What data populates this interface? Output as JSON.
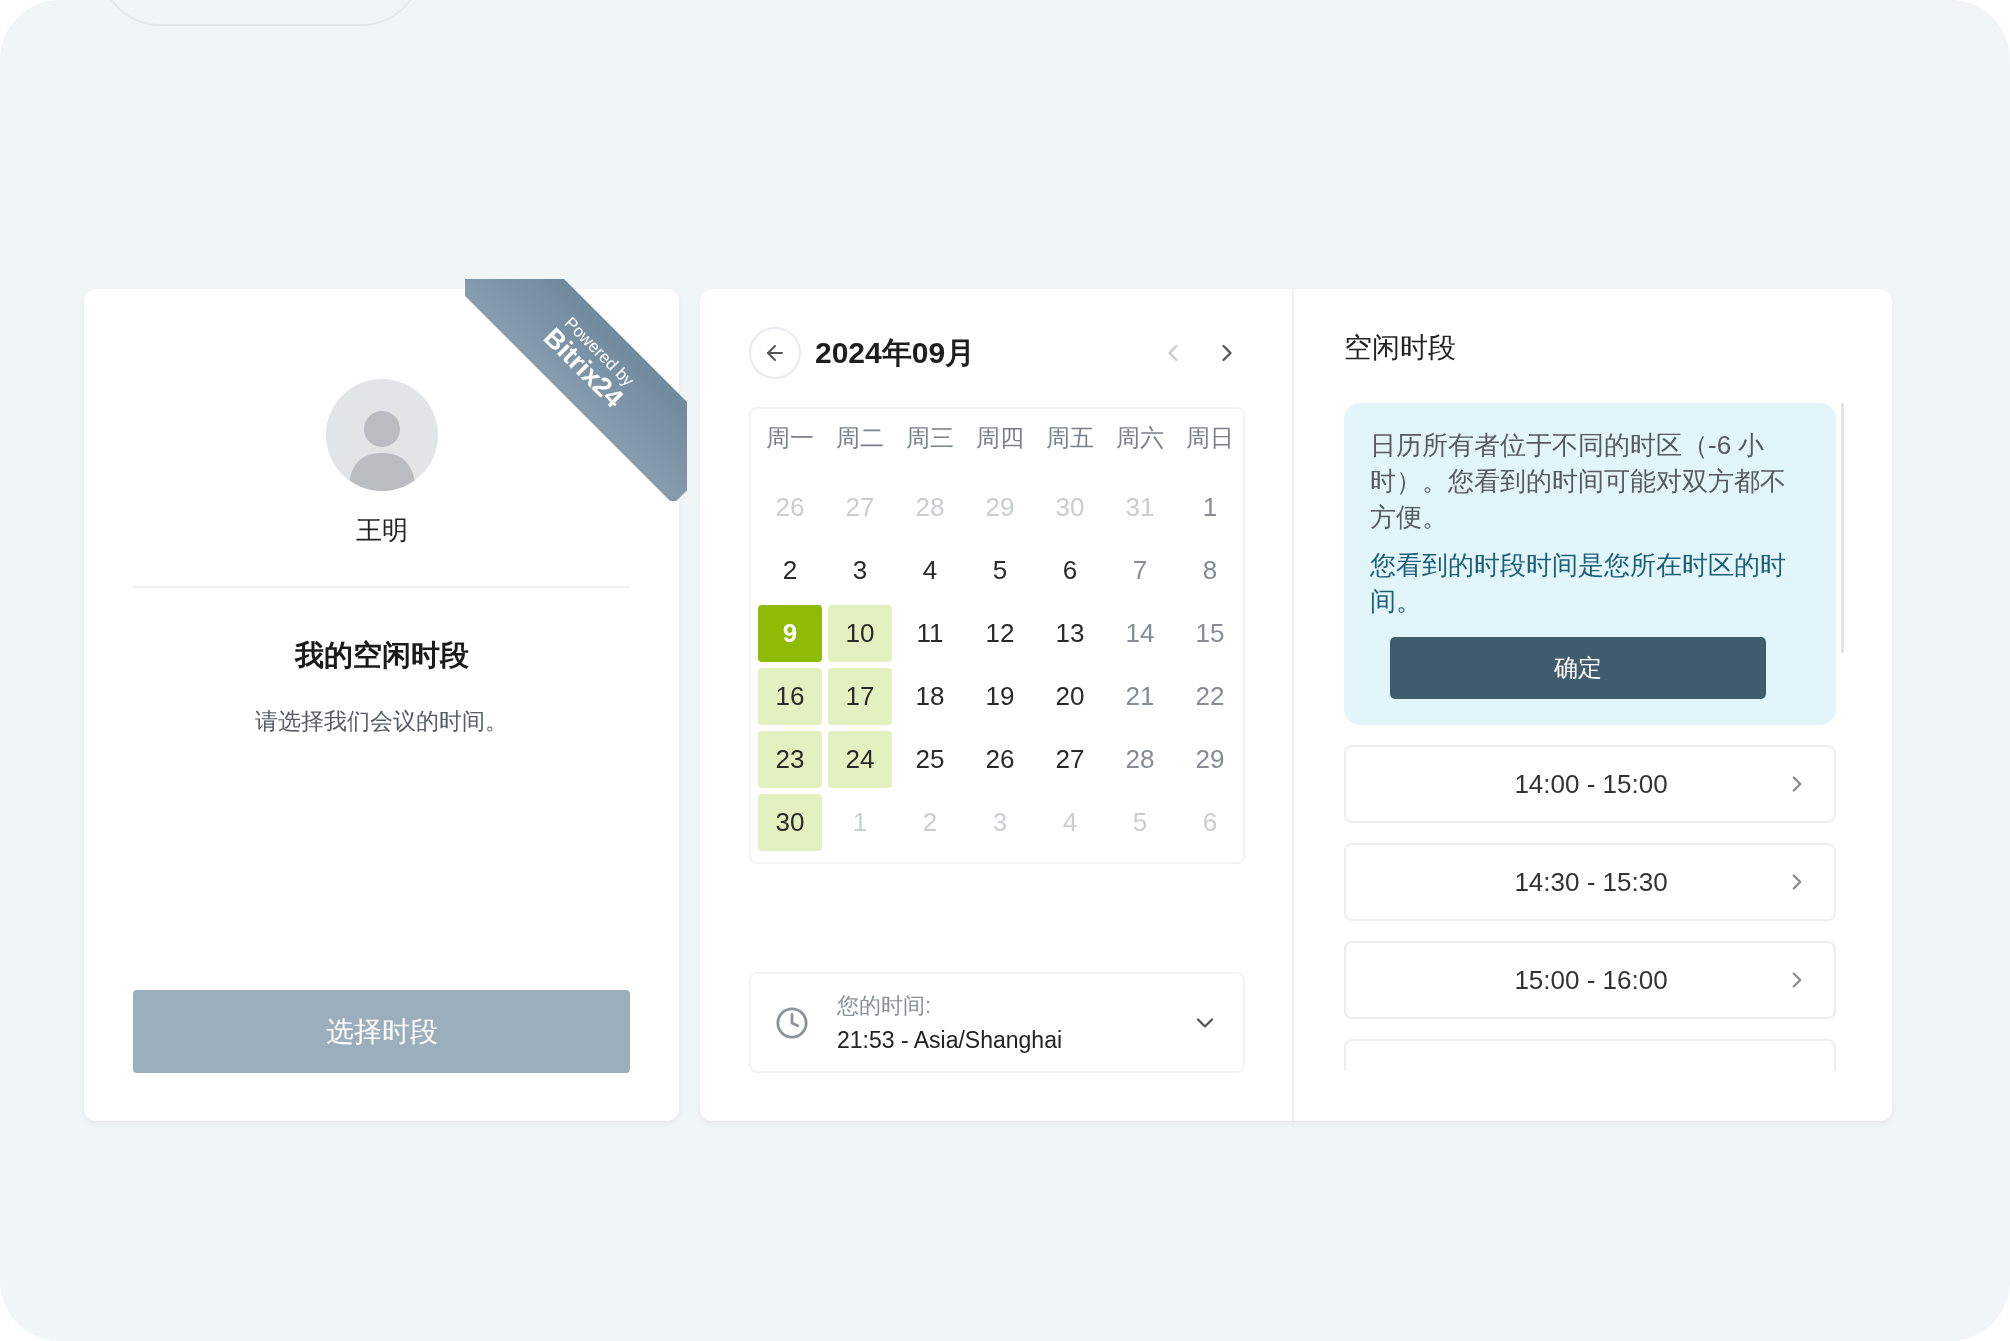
{
  "profile": {
    "name": "王明",
    "title": "我的空闲时段",
    "subtitle": "请选择我们会议的时间。",
    "action": "选择时段",
    "ribbon": {
      "line1": "Powered by",
      "line2": "Bitrix24"
    }
  },
  "calendar": {
    "month": "2024年09月",
    "weekdays": [
      "周一",
      "周二",
      "周三",
      "周四",
      "周五",
      "周六",
      "周日"
    ],
    "weeks": [
      [
        {
          "day": "26",
          "outside": true,
          "weekend": false,
          "available": false,
          "selected": false
        },
        {
          "day": "27",
          "outside": true,
          "weekend": false,
          "available": false,
          "selected": false
        },
        {
          "day": "28",
          "outside": true,
          "weekend": false,
          "available": false,
          "selected": false
        },
        {
          "day": "29",
          "outside": true,
          "weekend": false,
          "available": false,
          "selected": false
        },
        {
          "day": "30",
          "outside": true,
          "weekend": false,
          "available": false,
          "selected": false
        },
        {
          "day": "31",
          "outside": true,
          "weekend": true,
          "available": false,
          "selected": false
        },
        {
          "day": "1",
          "outside": false,
          "weekend": true,
          "available": false,
          "selected": false
        }
      ],
      [
        {
          "day": "2",
          "outside": false,
          "weekend": false,
          "available": false,
          "selected": false
        },
        {
          "day": "3",
          "outside": false,
          "weekend": false,
          "available": false,
          "selected": false
        },
        {
          "day": "4",
          "outside": false,
          "weekend": false,
          "available": false,
          "selected": false
        },
        {
          "day": "5",
          "outside": false,
          "weekend": false,
          "available": false,
          "selected": false
        },
        {
          "day": "6",
          "outside": false,
          "weekend": false,
          "available": false,
          "selected": false
        },
        {
          "day": "7",
          "outside": false,
          "weekend": true,
          "available": false,
          "selected": false
        },
        {
          "day": "8",
          "outside": false,
          "weekend": true,
          "available": false,
          "selected": false
        }
      ],
      [
        {
          "day": "9",
          "outside": false,
          "weekend": false,
          "available": true,
          "selected": true
        },
        {
          "day": "10",
          "outside": false,
          "weekend": false,
          "available": true,
          "selected": false
        },
        {
          "day": "11",
          "outside": false,
          "weekend": false,
          "available": false,
          "selected": false
        },
        {
          "day": "12",
          "outside": false,
          "weekend": false,
          "available": false,
          "selected": false
        },
        {
          "day": "13",
          "outside": false,
          "weekend": false,
          "available": false,
          "selected": false
        },
        {
          "day": "14",
          "outside": false,
          "weekend": true,
          "available": false,
          "selected": false
        },
        {
          "day": "15",
          "outside": false,
          "weekend": true,
          "available": false,
          "selected": false
        }
      ],
      [
        {
          "day": "16",
          "outside": false,
          "weekend": false,
          "available": true,
          "selected": false
        },
        {
          "day": "17",
          "outside": false,
          "weekend": false,
          "available": true,
          "selected": false
        },
        {
          "day": "18",
          "outside": false,
          "weekend": false,
          "available": false,
          "selected": false
        },
        {
          "day": "19",
          "outside": false,
          "weekend": false,
          "available": false,
          "selected": false
        },
        {
          "day": "20",
          "outside": false,
          "weekend": false,
          "available": false,
          "selected": false
        },
        {
          "day": "21",
          "outside": false,
          "weekend": true,
          "available": false,
          "selected": false
        },
        {
          "day": "22",
          "outside": false,
          "weekend": true,
          "available": false,
          "selected": false
        }
      ],
      [
        {
          "day": "23",
          "outside": false,
          "weekend": false,
          "available": true,
          "selected": false
        },
        {
          "day": "24",
          "outside": false,
          "weekend": false,
          "available": true,
          "selected": false
        },
        {
          "day": "25",
          "outside": false,
          "weekend": false,
          "available": false,
          "selected": false
        },
        {
          "day": "26",
          "outside": false,
          "weekend": false,
          "available": false,
          "selected": false
        },
        {
          "day": "27",
          "outside": false,
          "weekend": false,
          "available": false,
          "selected": false
        },
        {
          "day": "28",
          "outside": false,
          "weekend": true,
          "available": false,
          "selected": false
        },
        {
          "day": "29",
          "outside": false,
          "weekend": true,
          "available": false,
          "selected": false
        }
      ],
      [
        {
          "day": "30",
          "outside": false,
          "weekend": false,
          "available": true,
          "selected": false
        },
        {
          "day": "1",
          "outside": true,
          "weekend": false,
          "available": false,
          "selected": false
        },
        {
          "day": "2",
          "outside": true,
          "weekend": false,
          "available": false,
          "selected": false
        },
        {
          "day": "3",
          "outside": true,
          "weekend": false,
          "available": false,
          "selected": false
        },
        {
          "day": "4",
          "outside": true,
          "weekend": false,
          "available": false,
          "selected": false
        },
        {
          "day": "5",
          "outside": true,
          "weekend": true,
          "available": false,
          "selected": false
        },
        {
          "day": "6",
          "outside": true,
          "weekend": true,
          "available": false,
          "selected": false
        }
      ]
    ],
    "prev_disabled": true,
    "timezone": {
      "label": "您的时间:",
      "value": "21:53 - Asia/Shanghai"
    }
  },
  "slots": {
    "title": "空闲时段",
    "notice": {
      "text": "日历所有者位于不同的时区（-6 小时）。您看到的时间可能对双方都不方便。",
      "highlight": "您看到的时段时间是您所在时区的时间。",
      "button": "确定"
    },
    "items": [
      "14:00 - 15:00",
      "14:30 - 15:30",
      "15:00 - 16:00"
    ],
    "partial_item_visible": true
  }
}
